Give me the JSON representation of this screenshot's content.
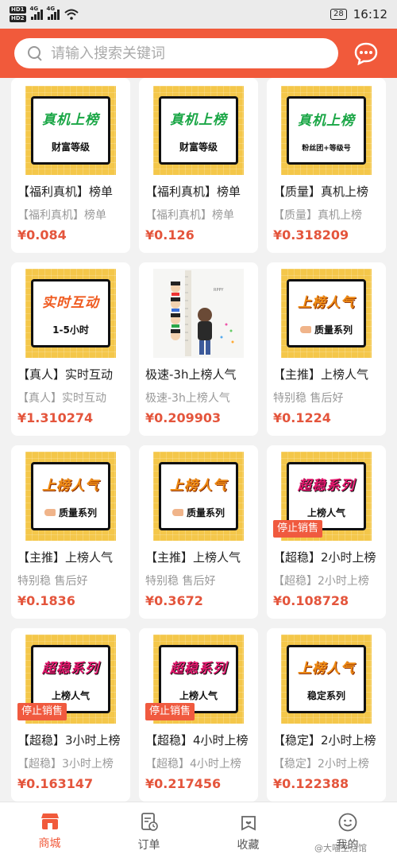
{
  "status_bar": {
    "hd1": "HD1",
    "hd2": "HD2",
    "net1": "4G",
    "net2": "4G",
    "battery": "28",
    "time": "16:12"
  },
  "search": {
    "placeholder": "请输入搜索关键词"
  },
  "colors": {
    "brand": "#f15a3b",
    "price": "#e4553c",
    "thumb_bg": "#f4c74a"
  },
  "products": [
    {
      "thumb_big": "真机上榜",
      "thumb_small": "财富等级",
      "title": "【福利真机】榜单",
      "subtitle": "【福利真机】榜单",
      "price": "¥0.084"
    },
    {
      "thumb_big": "真机上榜",
      "thumb_small": "财富等级",
      "title": "【福利真机】榜单",
      "subtitle": "【福利真机】榜单",
      "price": "¥0.126"
    },
    {
      "thumb_big": "真机上榜",
      "thumb_small": "粉丝团+等级号",
      "title": "【质量】真机上榜",
      "subtitle": "【质量】真机上榜",
      "price": "¥0.318209"
    },
    {
      "thumb_big": "实时互动",
      "thumb_small": "1-5小时",
      "title": "【真人】实时互动",
      "subtitle": "【真人】实时互动",
      "price": "¥1.310274"
    },
    {
      "title": "极速-3h上榜人气",
      "subtitle": "极速-3h上榜人气",
      "price": "¥0.209903"
    },
    {
      "thumb_big": "上榜人气",
      "thumb_small": "质量系列",
      "title": "【主推】上榜人气",
      "subtitle": "特别稳 售后好",
      "price": "¥0.1224"
    },
    {
      "thumb_big": "上榜人气",
      "thumb_small": "质量系列",
      "title": "【主推】上榜人气",
      "subtitle": "特别稳 售后好",
      "price": "¥0.1836"
    },
    {
      "thumb_big": "上榜人气",
      "thumb_small": "质量系列",
      "title": "【主推】上榜人气",
      "subtitle": "特别稳 售后好",
      "price": "¥0.3672"
    },
    {
      "thumb_big": "超稳系列",
      "thumb_small": "上榜人气",
      "tag": "停止销售",
      "title": "【超稳】2小时上榜",
      "subtitle": "【超稳】2小时上榜",
      "price": "¥0.108728"
    },
    {
      "thumb_big": "超稳系列",
      "thumb_small": "上榜人气",
      "tag": "停止销售",
      "title": "【超稳】3小时上榜",
      "subtitle": "【超稳】3小时上榜",
      "price": "¥0.163147"
    },
    {
      "thumb_big": "超稳系列",
      "thumb_small": "上榜人气",
      "tag": "停止销售",
      "title": "【超稳】4小时上榜",
      "subtitle": "【超稳】4小时上榜",
      "price": "¥0.217456"
    },
    {
      "thumb_big": "上榜人气",
      "thumb_small": "稳定系列",
      "title": "【稳定】2小时上榜",
      "subtitle": "【稳定】2小时上榜",
      "price": "¥0.122388"
    }
  ],
  "photo": {
    "ruler_text": "RPPY"
  },
  "tabbar": {
    "items": [
      {
        "label": "商城",
        "icon": "store-icon",
        "active": true
      },
      {
        "label": "订单",
        "icon": "order-icon"
      },
      {
        "label": "收藏",
        "icon": "favorite-icon"
      },
      {
        "label": "我的",
        "icon": "profile-icon"
      }
    ]
  },
  "watermark": "@大喵生活馆"
}
